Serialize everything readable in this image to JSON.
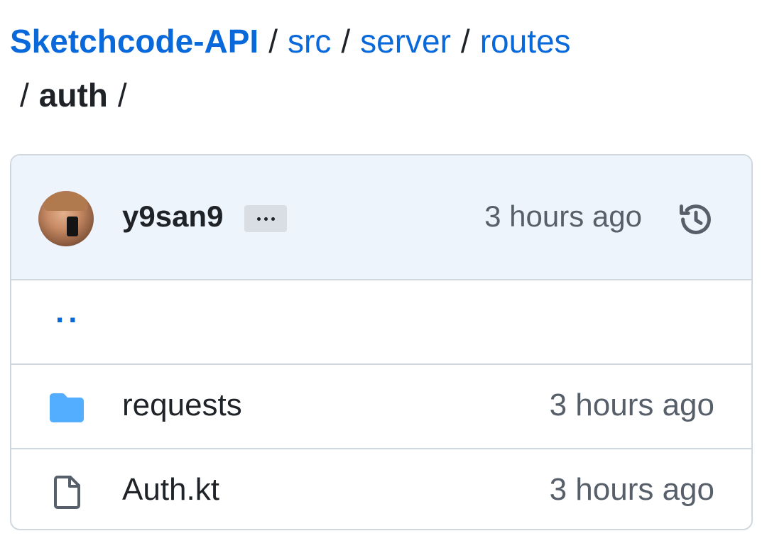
{
  "breadcrumb": {
    "repo": "Sketchcode-API",
    "segments": [
      "src",
      "server",
      "routes"
    ],
    "current": "auth",
    "separator": "/"
  },
  "latest_commit": {
    "author": "y9san9",
    "more_label": "…",
    "time": "3 hours ago"
  },
  "parent_link": "..",
  "files": [
    {
      "name": "requests",
      "type": "folder",
      "time": "3 hours ago",
      "icon": "folder-icon"
    },
    {
      "name": "Auth.kt",
      "type": "file",
      "time": "3 hours ago",
      "icon": "file-icon"
    }
  ],
  "colors": {
    "link": "#0969da",
    "folder": "#54aeff",
    "header_bg": "#eef4fb",
    "muted": "#57606a"
  }
}
